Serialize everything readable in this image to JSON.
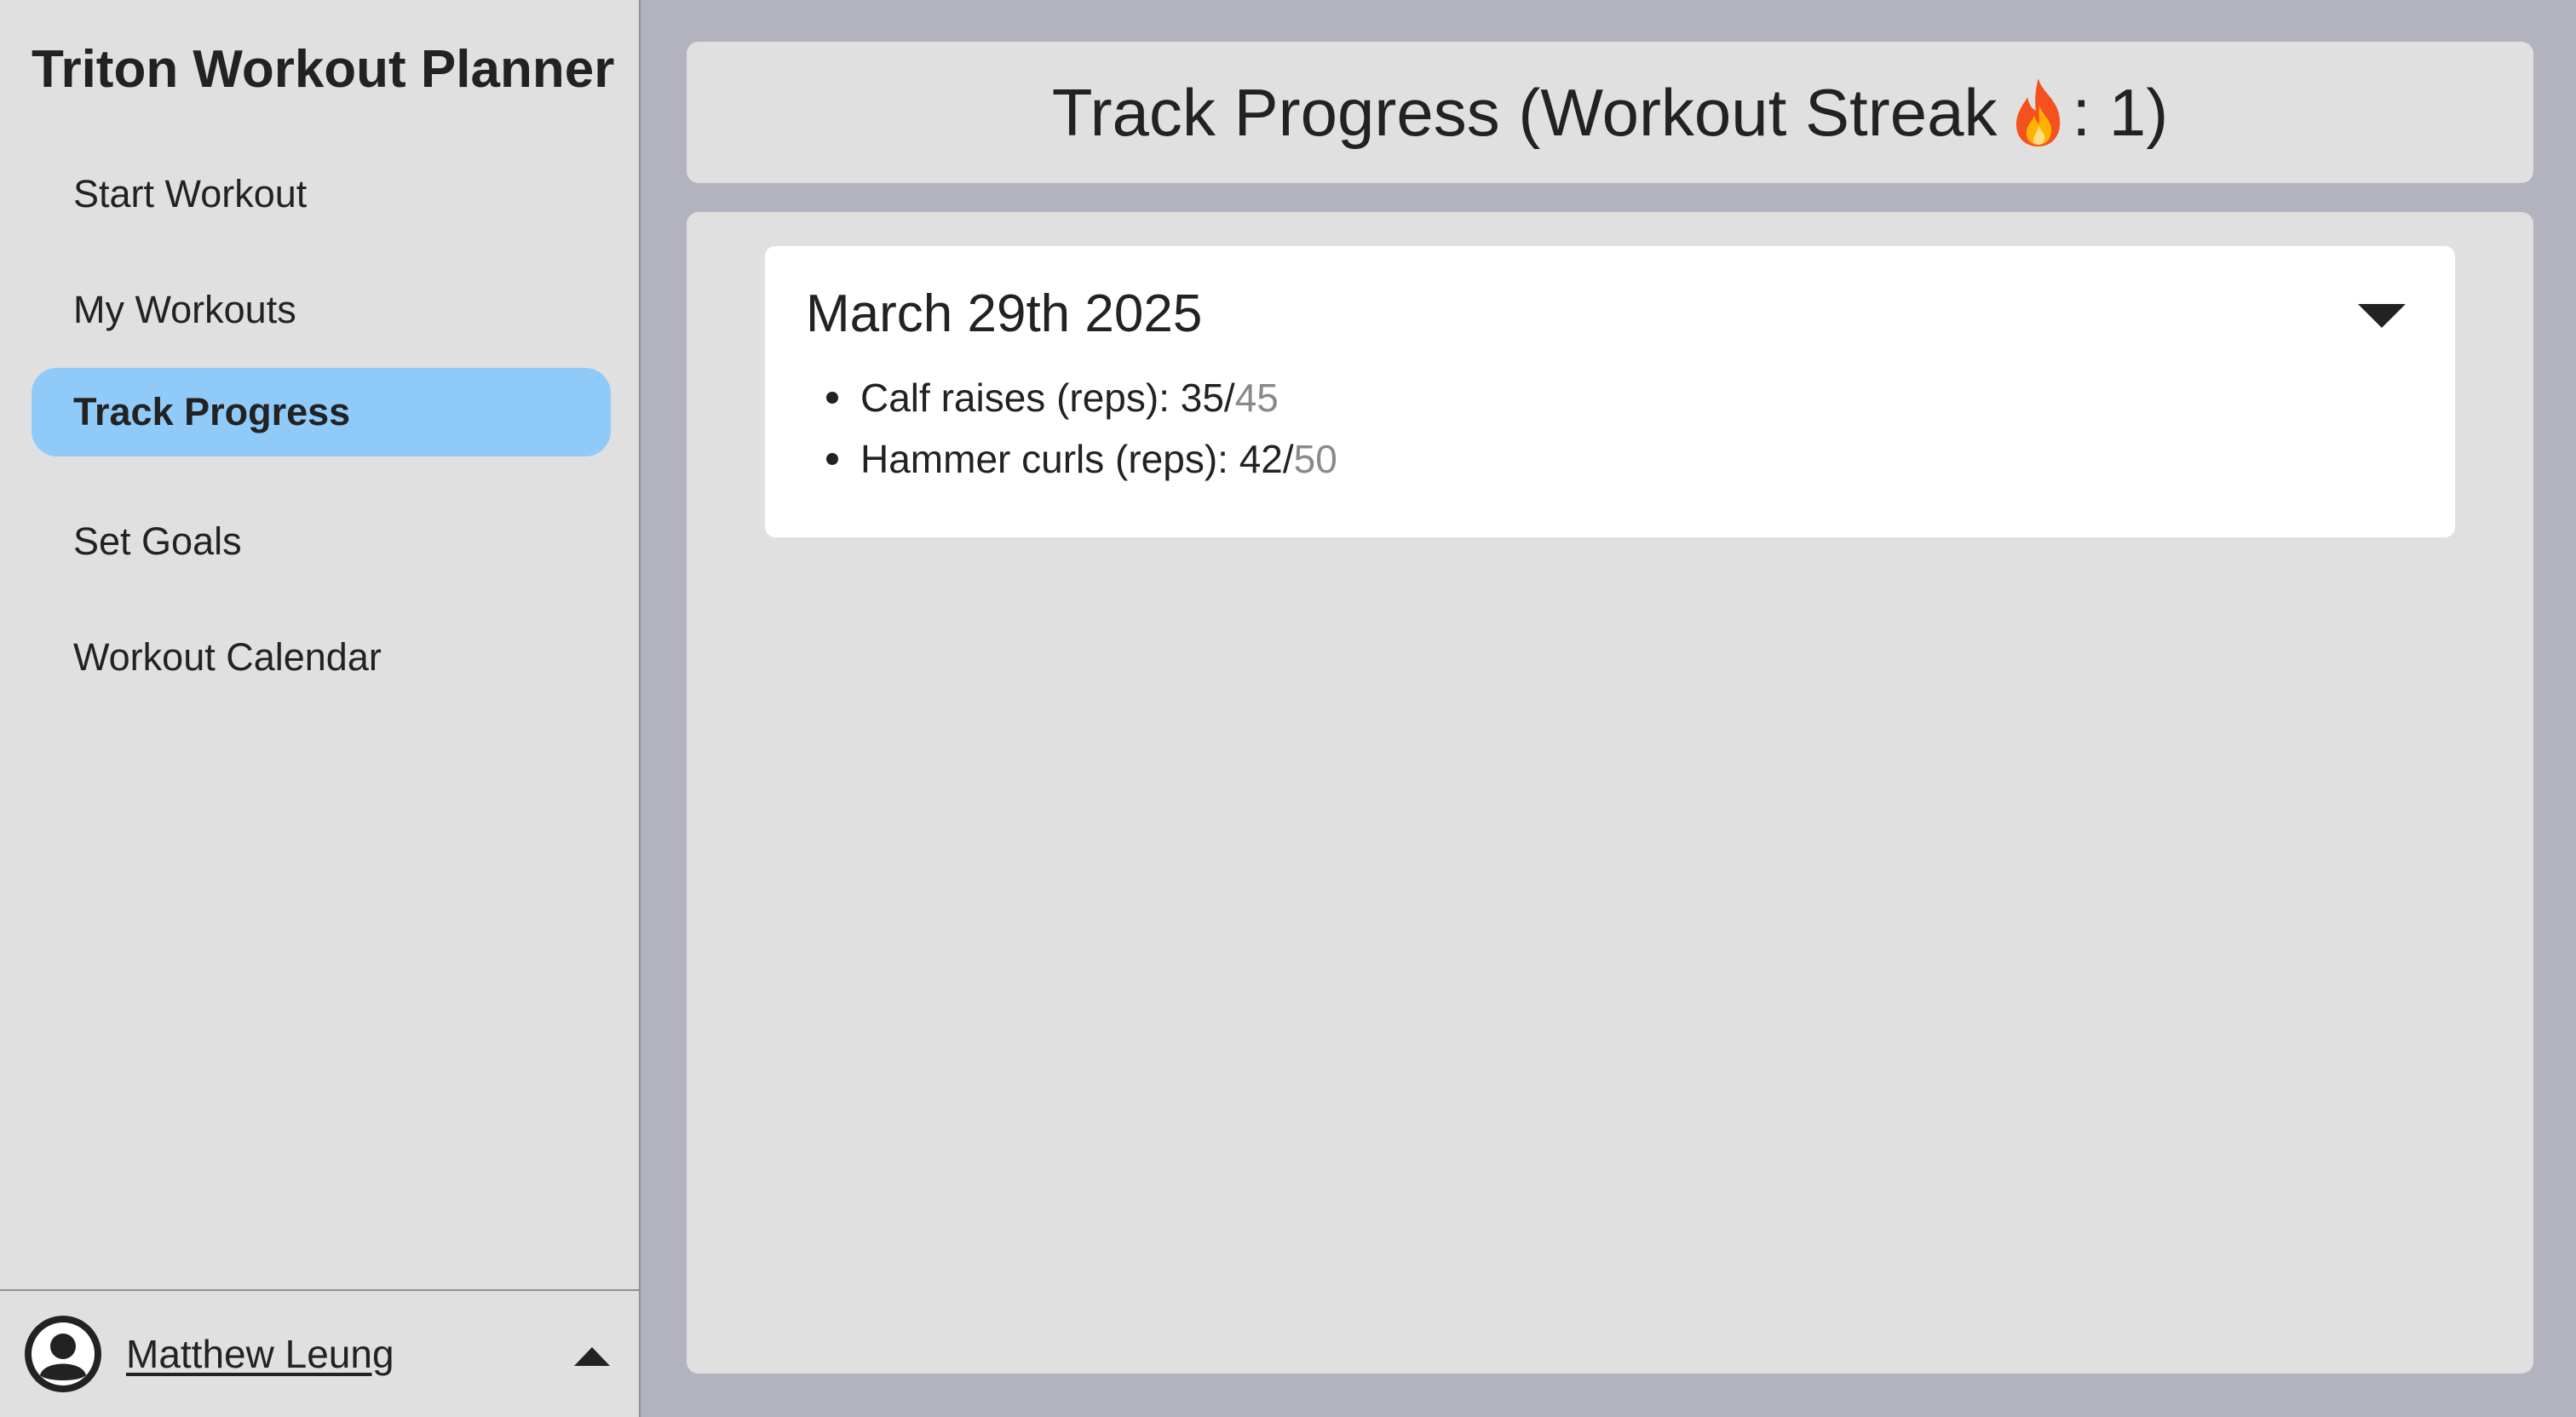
{
  "app": {
    "title": "Triton Workout Planner"
  },
  "sidebar": {
    "items": [
      {
        "label": "Start Workout",
        "active": false
      },
      {
        "label": "My Workouts",
        "active": false
      },
      {
        "label": "Track Progress",
        "active": true
      },
      {
        "label": "Set Goals",
        "active": false
      },
      {
        "label": "Workout Calendar",
        "active": false
      }
    ],
    "user": {
      "name": "Matthew Leung",
      "avatar_icon": "user-circle-icon",
      "menu_icon": "caret-up-icon"
    }
  },
  "header": {
    "title_prefix": "Track Progress (Workout Streak ",
    "streak_icon": "fire-icon",
    "title_suffix": ": 1)",
    "streak_count": 1
  },
  "progress": {
    "entries": [
      {
        "date": "March 29th 2025",
        "toggle_icon": "caret-down-icon",
        "exercises": [
          {
            "label": "Calf raises (reps): ",
            "done": "35",
            "separator": "/",
            "goal": "45"
          },
          {
            "label": "Hammer curls (reps): ",
            "done": "42",
            "separator": "/",
            "goal": "50"
          }
        ]
      }
    ]
  },
  "colors": {
    "page_background": "#b2b3be",
    "panel_background": "#e0e0e0",
    "active_nav": "#90caf9",
    "goal_text": "#8a8a8a"
  }
}
